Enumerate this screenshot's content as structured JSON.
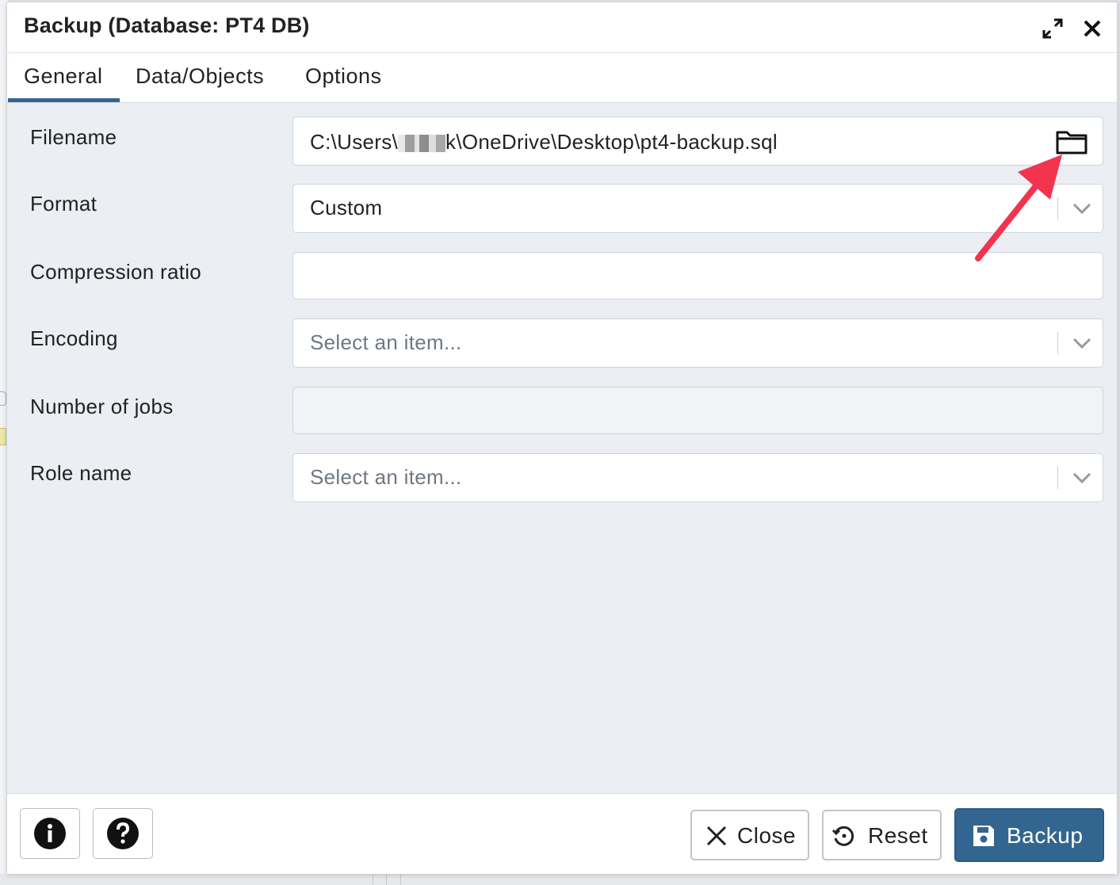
{
  "dialog": {
    "title": "Backup (Database: PT4 DB)",
    "maximize_icon": "expand-arrows-icon",
    "close_icon": "close-x-icon"
  },
  "tabs": [
    {
      "label": "General",
      "active": true
    },
    {
      "label": "Data/Objects",
      "active": false
    },
    {
      "label": "Options",
      "active": false
    }
  ],
  "form": {
    "filename": {
      "label": "Filename",
      "value_prefix": "C:\\Users\\",
      "value_suffix": "k\\OneDrive\\Desktop\\pt4-backup.sql",
      "icon": "folder-icon"
    },
    "format": {
      "label": "Format",
      "value": "Custom"
    },
    "compression": {
      "label": "Compression ratio",
      "value": ""
    },
    "encoding": {
      "label": "Encoding",
      "placeholder": "Select an item..."
    },
    "jobs": {
      "label": "Number of jobs",
      "value": ""
    },
    "role": {
      "label": "Role name",
      "placeholder": "Select an item..."
    }
  },
  "annotation": {
    "color": "#f2344f"
  },
  "footer": {
    "info_icon": "info-icon",
    "help_icon": "help-icon",
    "close_label": "Close",
    "reset_label": "Reset",
    "backup_label": "Backup"
  },
  "colors": {
    "accent": "#326690",
    "background": "#ebeef3"
  }
}
